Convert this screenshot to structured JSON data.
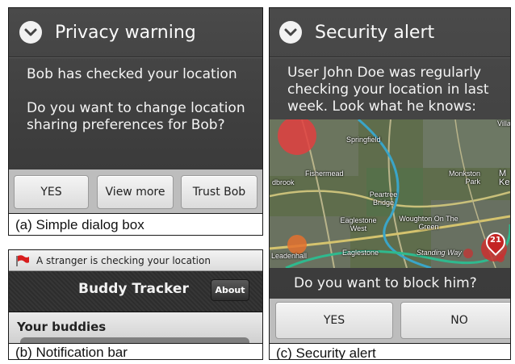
{
  "panel_a": {
    "title": "Privacy warning",
    "message1": "Bob has checked your location",
    "message2": "Do you want to change location sharing preferences for Bob?",
    "buttons": [
      "YES",
      "View more",
      "Trust Bob"
    ],
    "caption": "(a) Simple dialog box"
  },
  "panel_b": {
    "notification": "A stranger is checking your location",
    "app_title": "Buddy Tracker",
    "about_label": "About",
    "section": "Your buddies",
    "caption": "(b) Notification bar"
  },
  "panel_c": {
    "title": "Security alert",
    "message": "User John Doe was regularly checking your location in last week. Look what he knows:",
    "map_labels": [
      "Springfield",
      "Fishermead",
      "dbrook",
      "Monkston Park",
      "M Ke",
      "Peartree Bridge",
      "Eaglestone West",
      "Woughton On The Green",
      "Leadenhall",
      "Eaglestone",
      "Standing Way",
      "Villa"
    ],
    "marker_count": "21",
    "question": "Do you want to block him?",
    "buttons": [
      "YES",
      "NO"
    ],
    "caption": "(c) Security alert"
  },
  "colors": {
    "dialog_bg": "#424242",
    "button_bar": "#bdbdbd",
    "flag_red": "#d81c1c"
  }
}
